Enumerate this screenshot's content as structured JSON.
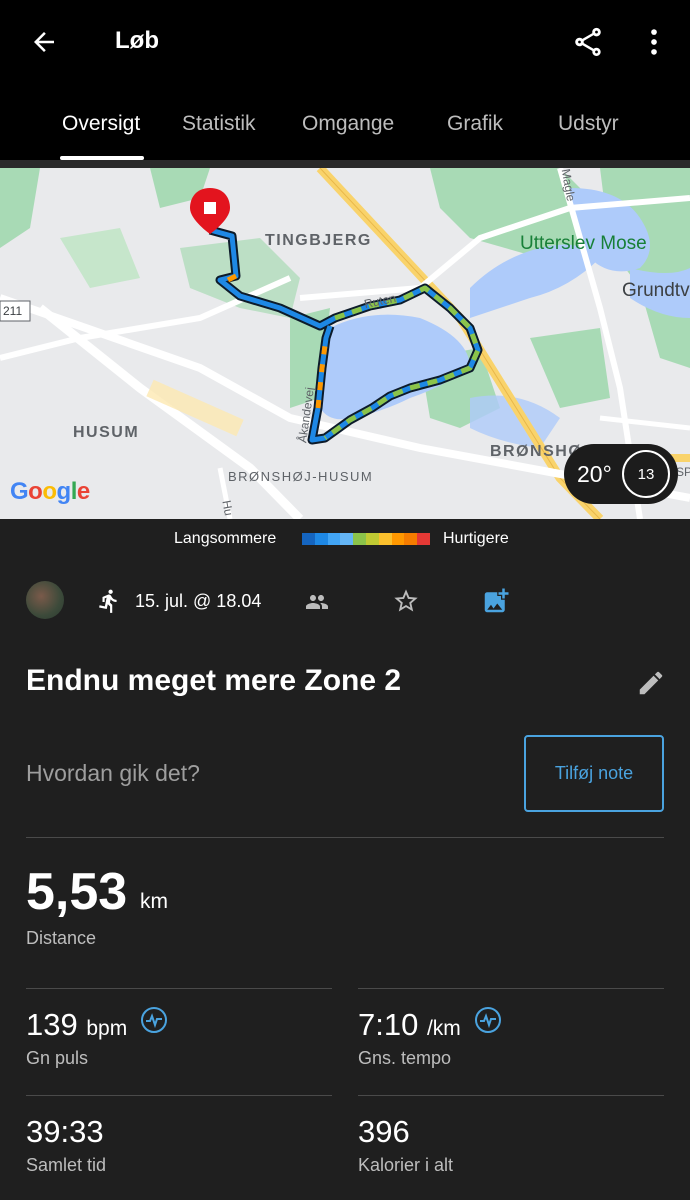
{
  "header": {
    "title": "Løb",
    "tabs": [
      {
        "label": "Oversigt",
        "active": true
      },
      {
        "label": "Statistik"
      },
      {
        "label": "Omgange"
      },
      {
        "label": "Grafik"
      },
      {
        "label": "Udstyr"
      }
    ],
    "icons": [
      "arrow-back-icon",
      "share-icon",
      "more-vert-icon"
    ]
  },
  "map": {
    "labels": {
      "tingbjerg": "TINGBJERG",
      "utterslev": "Utterslev Mose",
      "grundtv": "Grundtv",
      "husum": "HUSUM",
      "bronshoj": "BRØNSHØ",
      "bronshoj_husum": "BRØNSHØJ-HUSUM",
      "ruten": "Ruten",
      "akandevej": "Åkandevej",
      "magle": "Magle",
      "road_211": "211",
      "hu": "Hu",
      "sp": "SP"
    },
    "attribution": "Google",
    "weather": {
      "temp": "20°",
      "wind": "13"
    }
  },
  "legend": {
    "slower": "Langsommere",
    "faster": "Hurtigere",
    "colors": [
      "#1565c0",
      "#1e88e5",
      "#42a5f5",
      "#64b5f6",
      "#8bc34a",
      "#c0ca33",
      "#fbc02d",
      "#ff9800",
      "#f57c00",
      "#e53935"
    ]
  },
  "activity": {
    "date": "15. jul. @ 18.04",
    "title": "Endnu meget mere Zone 2",
    "note_question": "Hvordan gik det?",
    "note_button": "Tilføj note",
    "accent": "#4aa3df"
  },
  "stats": {
    "distance": {
      "value": "5,53",
      "unit": "km",
      "label": "Distance"
    },
    "heart_rate": {
      "value": "139",
      "unit": "bpm",
      "label": "Gn puls"
    },
    "pace": {
      "value": "7:10",
      "unit": "/km",
      "label": "Gns. tempo"
    },
    "time": {
      "value": "39:33",
      "label": "Samlet tid"
    },
    "calories": {
      "value": "396",
      "label": "Kalorier i alt"
    }
  }
}
